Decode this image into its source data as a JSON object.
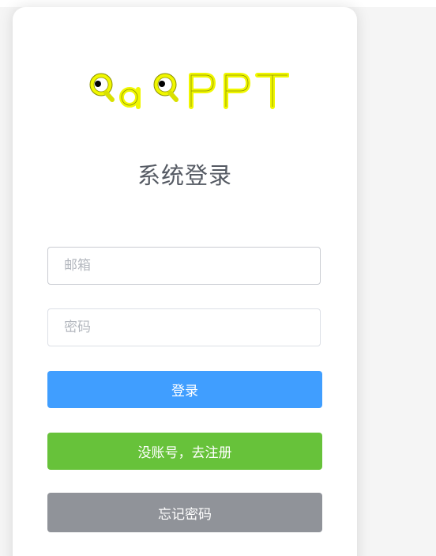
{
  "logo": {
    "text": "QaQPPT",
    "primary_color": "#f0f700",
    "outline_color": "#8a8f00"
  },
  "page_title": "系统登录",
  "form": {
    "email_placeholder": "邮箱",
    "email_value": "",
    "password_placeholder": "密码",
    "password_value": ""
  },
  "buttons": {
    "login_label": "登录",
    "register_label": "没账号，去注册",
    "forgot_label": "忘记密码"
  },
  "colors": {
    "login_button": "#409eff",
    "register_button": "#67c23a",
    "forgot_button": "#909399"
  }
}
